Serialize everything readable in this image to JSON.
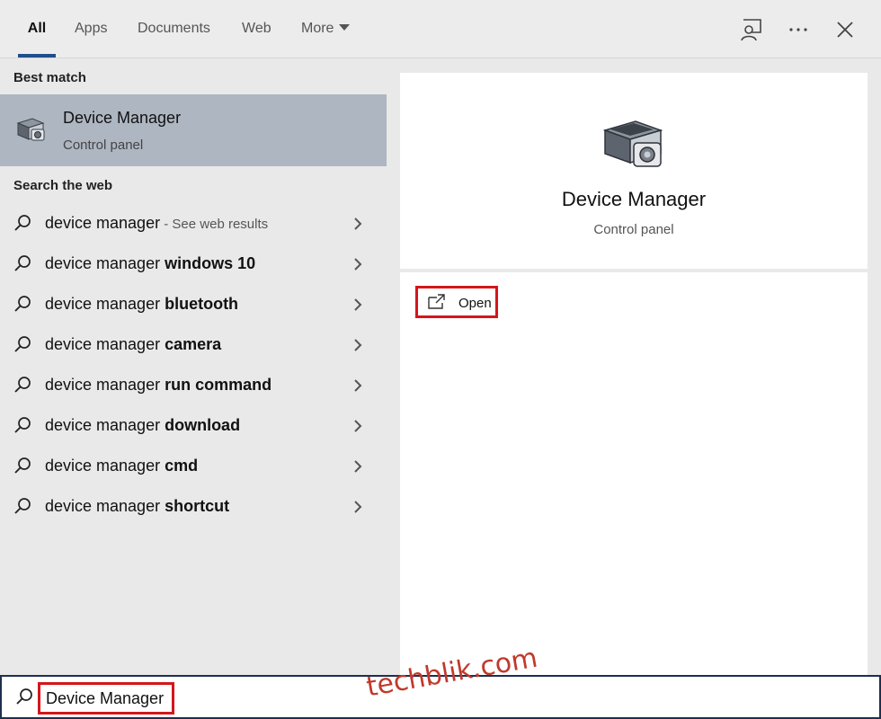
{
  "tabs": [
    {
      "label": "All"
    },
    {
      "label": "Apps"
    },
    {
      "label": "Documents"
    },
    {
      "label": "Web"
    },
    {
      "label": "More"
    }
  ],
  "toolbar_icons": [
    "feedback-icon",
    "more-options-icon",
    "close-icon"
  ],
  "best_match": {
    "header": "Best match",
    "title": "Device Manager",
    "subtitle": "Control panel",
    "icon": "device-manager-icon"
  },
  "web": {
    "header": "Search the web",
    "items": [
      {
        "prefix": "device manager",
        "bold": "",
        "suffix": " - See web results"
      },
      {
        "prefix": "device manager ",
        "bold": "windows 10",
        "suffix": ""
      },
      {
        "prefix": "device manager ",
        "bold": "bluetooth",
        "suffix": ""
      },
      {
        "prefix": "device manager ",
        "bold": "camera",
        "suffix": ""
      },
      {
        "prefix": "device manager ",
        "bold": "run command",
        "suffix": ""
      },
      {
        "prefix": "device manager ",
        "bold": "download",
        "suffix": ""
      },
      {
        "prefix": "device manager ",
        "bold": "cmd",
        "suffix": ""
      },
      {
        "prefix": "device manager ",
        "bold": "shortcut",
        "suffix": ""
      }
    ]
  },
  "detail": {
    "title": "Device Manager",
    "subtitle": "Control panel",
    "open_label": "Open"
  },
  "search": {
    "value": "Device Manager"
  },
  "watermark": "techblik.com",
  "colors": {
    "selected_bg": "#aeb6c2",
    "accent": "#1f4e8c",
    "highlight": "#d4161c"
  }
}
